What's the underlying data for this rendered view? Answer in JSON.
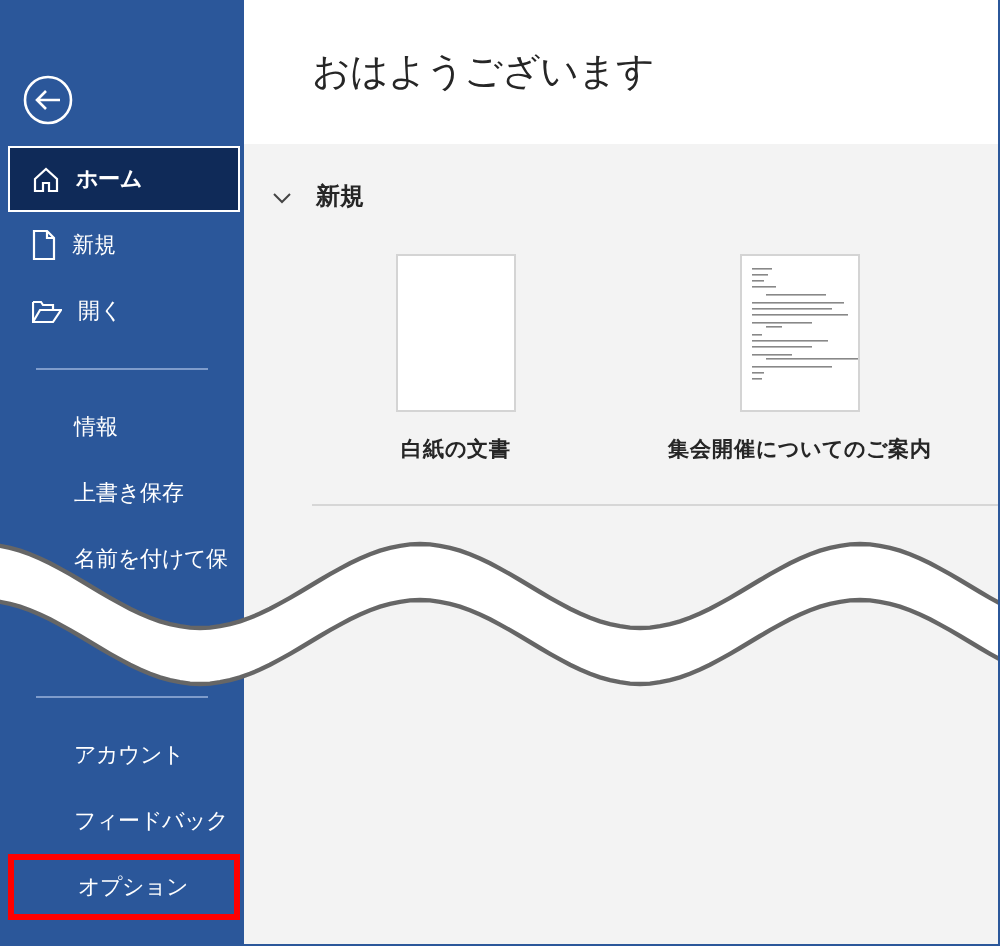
{
  "sidebar": {
    "items": [
      {
        "kind": "home",
        "label": "ホーム",
        "selected": true,
        "highlighted": false
      },
      {
        "kind": "new",
        "label": "新規",
        "selected": false,
        "highlighted": false
      },
      {
        "kind": "open",
        "label": "開く",
        "selected": false,
        "highlighted": false
      },
      {
        "kind": "divider"
      },
      {
        "kind": "plain",
        "label": "情報",
        "selected": false,
        "highlighted": false
      },
      {
        "kind": "plain",
        "label": "上書き保存",
        "selected": false,
        "highlighted": false
      },
      {
        "kind": "plain",
        "label": "名前を付けて保",
        "selected": false,
        "highlighted": false
      },
      {
        "kind": "break"
      },
      {
        "kind": "divider"
      },
      {
        "kind": "plain",
        "label": "アカウント",
        "selected": false,
        "highlighted": false
      },
      {
        "kind": "plain",
        "label": "フィードバック",
        "selected": false,
        "highlighted": false
      },
      {
        "kind": "plain",
        "label": "オプション",
        "selected": false,
        "highlighted": true
      }
    ]
  },
  "main": {
    "greeting": "おはようございます",
    "new_section": {
      "title": "新規",
      "expanded": true,
      "templates": [
        {
          "kind": "blank",
          "label": "白紙の文書"
        },
        {
          "kind": "letter",
          "label": "集会開催についてのご案内"
        }
      ]
    }
  }
}
